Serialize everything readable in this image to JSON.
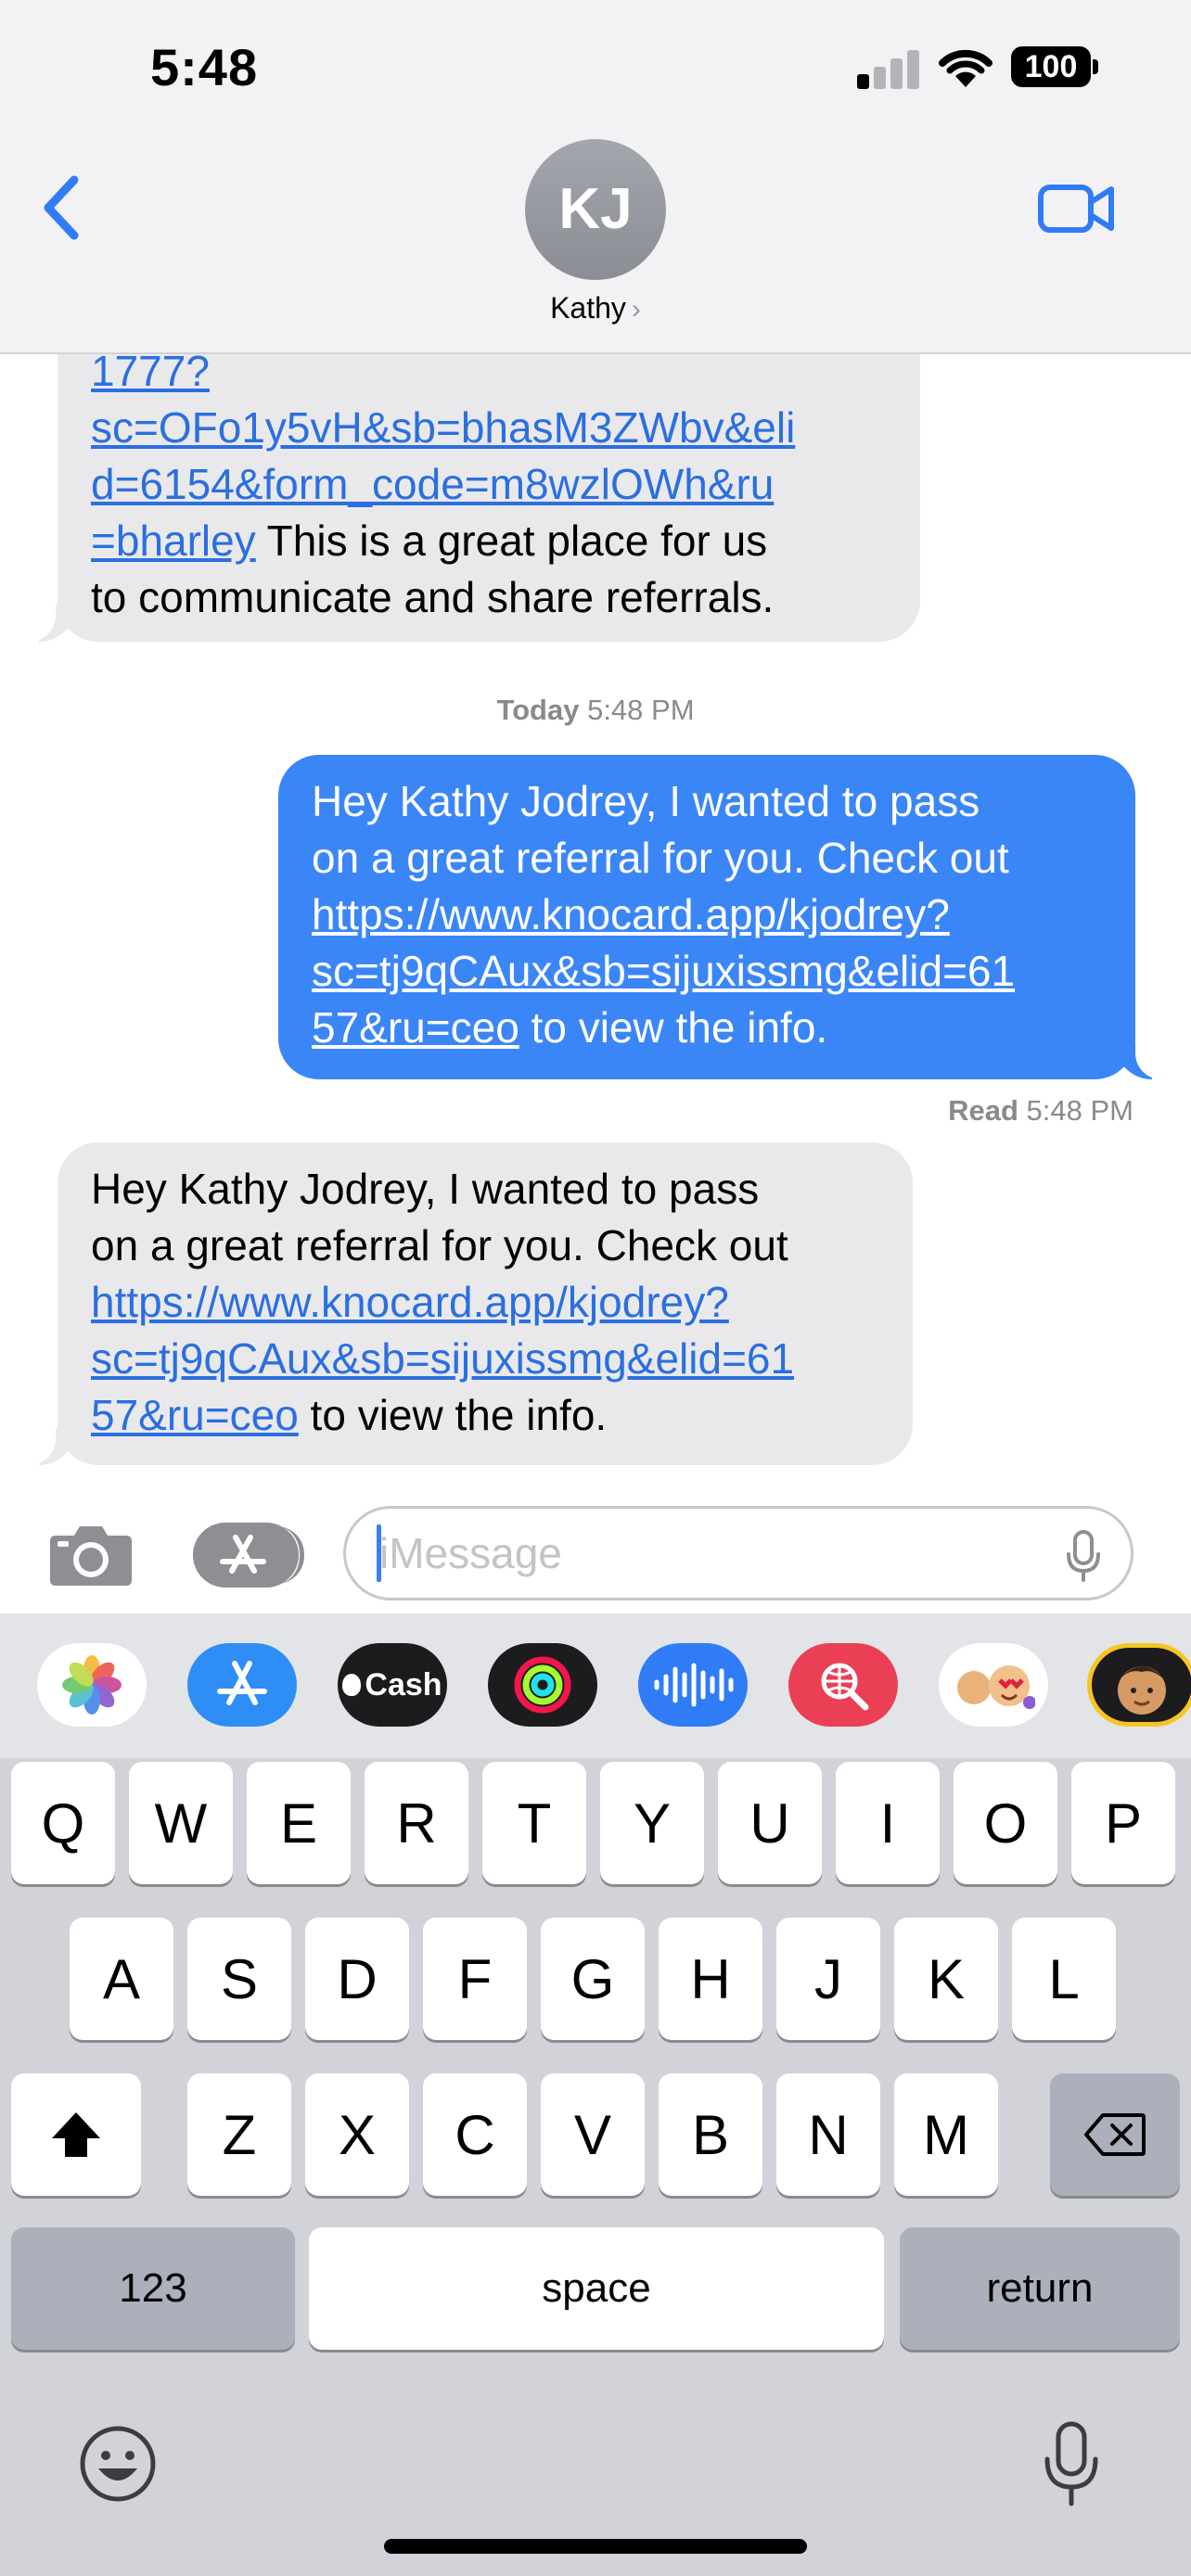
{
  "status_bar": {
    "time": "5:48",
    "battery": "100"
  },
  "header": {
    "avatar_initials": "KJ",
    "contact_name": "Kathy",
    "name_chevron": "›"
  },
  "messages": [
    {
      "direction": "received",
      "link_lines": [
        "1777?",
        "sc=OFo1y5vH&sb=bhasM3ZWbv&eli",
        "d=6154&form_code=m8wzlOWh&ru",
        "=bharley"
      ],
      "text_after_link": " This is a great place for us",
      "text_line_2": "to communicate and share referrals."
    },
    {
      "direction": "sent",
      "text_lines": [
        "Hey Kathy Jodrey, I wanted to pass",
        "on a great referral for you. Check out"
      ],
      "link_lines": [
        "https://www.knocard.app/kjodrey?",
        "sc=tj9qCAux&sb=sijuxissmg&elid=61",
        "57&ru=ceo"
      ],
      "text_after_link": " to view the info."
    },
    {
      "direction": "received",
      "text_lines": [
        "Hey Kathy Jodrey, I wanted to pass",
        "on a great referral for you. Check out"
      ],
      "link_lines": [
        "https://www.knocard.app/kjodrey?",
        "sc=tj9qCAux&sb=sijuxissmg&elid=61",
        "57&ru=ceo"
      ],
      "text_after_link": " to view the info."
    }
  ],
  "timestamp": {
    "day": "Today",
    "time": "5:48 PM"
  },
  "read_receipt": {
    "label": "Read",
    "time": "5:48 PM"
  },
  "input": {
    "placeholder": "iMessage"
  },
  "app_strip": [
    {
      "name": "photos-app-icon"
    },
    {
      "name": "app-store-icon"
    },
    {
      "name": "apple-cash-icon",
      "label": "Cash"
    },
    {
      "name": "activity-icon"
    },
    {
      "name": "audio-message-icon"
    },
    {
      "name": "web-search-icon"
    },
    {
      "name": "memoji-stickers-icon"
    },
    {
      "name": "memoji-icon"
    }
  ],
  "keyboard": {
    "row1": [
      "Q",
      "W",
      "E",
      "R",
      "T",
      "Y",
      "U",
      "I",
      "O",
      "P"
    ],
    "row2": [
      "A",
      "S",
      "D",
      "F",
      "G",
      "H",
      "J",
      "K",
      "L"
    ],
    "row3": [
      "Z",
      "X",
      "C",
      "V",
      "B",
      "N",
      "M"
    ],
    "numbers_label": "123",
    "space_label": "space",
    "return_label": "return"
  },
  "colors": {
    "sent_bubble": "#3b86f7",
    "received_bubble": "#e9e9eb",
    "link_received": "#2b6fe0",
    "accent": "#2f7cf6"
  }
}
